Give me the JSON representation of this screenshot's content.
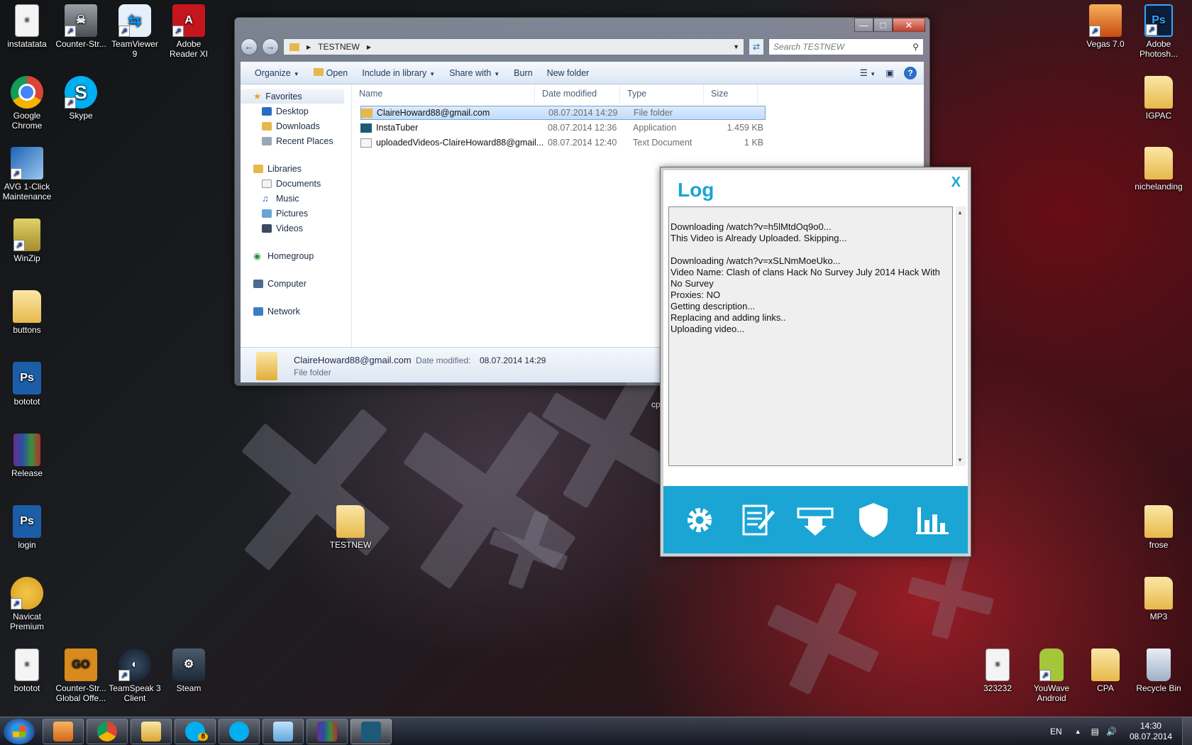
{
  "desktop": {
    "left_icons": [
      {
        "label": "instatatata",
        "icon": "document-icon"
      },
      {
        "label": "Counter-Str...",
        "icon": "counter-strike-icon"
      },
      {
        "label": "TeamViewer\n9",
        "icon": "teamviewer-icon"
      },
      {
        "label": "Adobe\nReader XI",
        "icon": "pdf-icon"
      },
      {
        "label": "Google\nChrome",
        "icon": "chrome-icon"
      },
      {
        "label": "Skype",
        "icon": "skype-icon"
      },
      {
        "label": "AVG 1-Click\nMaintenance",
        "icon": "avg-icon"
      },
      {
        "label": "WinZip",
        "icon": "winzip-icon"
      },
      {
        "label": "buttons",
        "icon": "folder-icon"
      },
      {
        "label": "bototot",
        "icon": "psd-icon"
      },
      {
        "label": "Release",
        "icon": "winrar-icon"
      },
      {
        "label": "login",
        "icon": "psd-icon"
      },
      {
        "label": "Navicat\nPremium",
        "icon": "navicat-icon"
      },
      {
        "label": "bototot",
        "icon": "document-icon"
      },
      {
        "label": "Counter-Str...\nGlobal Offe...",
        "icon": "csgo-icon"
      },
      {
        "label": "TeamSpeak 3\nClient",
        "icon": "teamspeak-icon"
      },
      {
        "label": "Steam",
        "icon": "steam-icon"
      }
    ],
    "center_icon": {
      "label": "TESTNEW",
      "icon": "folder-icon"
    },
    "right_icons": [
      {
        "label": "Vegas 7.0",
        "icon": "vegas-icon"
      },
      {
        "label": "Adobe\nPhotosh...",
        "icon": "photoshop-icon"
      },
      {
        "label": "IGPAC",
        "icon": "folder-icon"
      },
      {
        "label": "nichelanding",
        "icon": "folder-icon"
      },
      {
        "label": "frose",
        "icon": "folder-icon"
      },
      {
        "label": "MP3",
        "icon": "folder-icon"
      },
      {
        "label": "323232",
        "icon": "document-icon"
      },
      {
        "label": "YouWave\nAndroid",
        "icon": "android-icon"
      },
      {
        "label": "CPA",
        "icon": "folder-icon"
      },
      {
        "label": "Recycle Bin",
        "icon": "recycle-bin-icon"
      }
    ],
    "hidden_label_fragment": "cp"
  },
  "explorer": {
    "breadcrumb": "TESTNEW",
    "search_placeholder": "Search TESTNEW",
    "toolbar": {
      "organize": "Organize",
      "open": "Open",
      "include_in_library": "Include in library",
      "share_with": "Share with",
      "burn": "Burn",
      "new_folder": "New folder"
    },
    "nav": {
      "favorites": "Favorites",
      "desktop": "Desktop",
      "downloads": "Downloads",
      "recent_places": "Recent Places",
      "libraries": "Libraries",
      "documents": "Documents",
      "music": "Music",
      "pictures": "Pictures",
      "videos": "Videos",
      "homegroup": "Homegroup",
      "computer": "Computer",
      "network": "Network"
    },
    "columns": {
      "name": "Name",
      "date": "Date modified",
      "type": "Type",
      "size": "Size"
    },
    "files": [
      {
        "name": "ClaireHoward88@gmail.com",
        "date": "08.07.2014 14:29",
        "type": "File folder",
        "size": "",
        "icon": "folder-icon",
        "selected": true
      },
      {
        "name": "InstaTuber",
        "date": "08.07.2014 12:36",
        "type": "Application",
        "size": "1.459 KB",
        "icon": "app-icon",
        "selected": false
      },
      {
        "name": "uploadedVideos-ClaireHoward88@gmail...",
        "date": "08.07.2014 12:40",
        "type": "Text Document",
        "size": "1 KB",
        "icon": "text-file-icon",
        "selected": false
      }
    ],
    "details": {
      "name": "ClaireHoward88@gmail.com",
      "date_label": "Date modified:",
      "date_value": "08.07.2014 14:29",
      "type": "File folder"
    }
  },
  "log_window": {
    "title": "Log",
    "close": "X",
    "text": "Downloading /watch?v=h5lMtdOq9o0...\nThis Video is Already Uploaded. Skipping...\n\nDownloading /watch?v=xSLNmMoeUko...\nVideo Name: Clash of clans Hack No Survey July 2014 Hack With No Survey\nProxies: NO\nGetting description...\nReplacing and adding links..\nUploading video...",
    "bottom_icons": [
      "settings-icon",
      "notes-icon",
      "upload-icon",
      "shield-icon",
      "stats-icon"
    ],
    "accent": "#1aa5d4"
  },
  "taskbar": {
    "apps": [
      "media-player-icon",
      "chrome-icon",
      "explorer-icon",
      "skype-notify-icon",
      "skype-icon",
      "notepad-icon",
      "winrar-icon",
      "instatuber-icon"
    ],
    "skype_badge": "8",
    "language": "EN",
    "time": "14:30",
    "date": "08.07.2014"
  }
}
